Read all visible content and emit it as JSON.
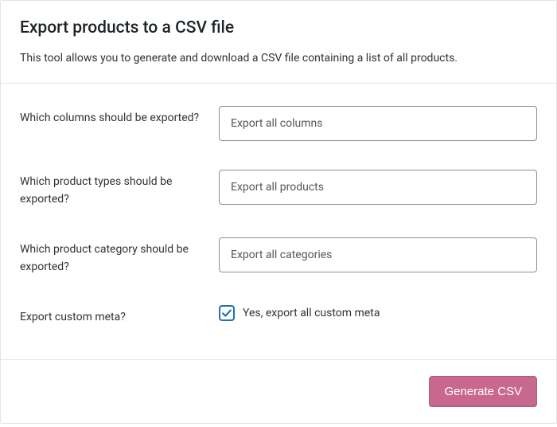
{
  "header": {
    "title": "Export products to a CSV file",
    "description": "This tool allows you to generate and download a CSV file containing a list of all products."
  },
  "form": {
    "columns": {
      "label": "Which columns should be exported?",
      "placeholder": "Export all columns"
    },
    "product_types": {
      "label": "Which product types should be exported?",
      "placeholder": "Export all products"
    },
    "categories": {
      "label": "Which product category should be exported?",
      "placeholder": "Export all categories"
    },
    "custom_meta": {
      "label": "Export custom meta?",
      "checkbox_label": "Yes, export all custom meta",
      "checked": true
    }
  },
  "footer": {
    "button_label": "Generate CSV"
  }
}
